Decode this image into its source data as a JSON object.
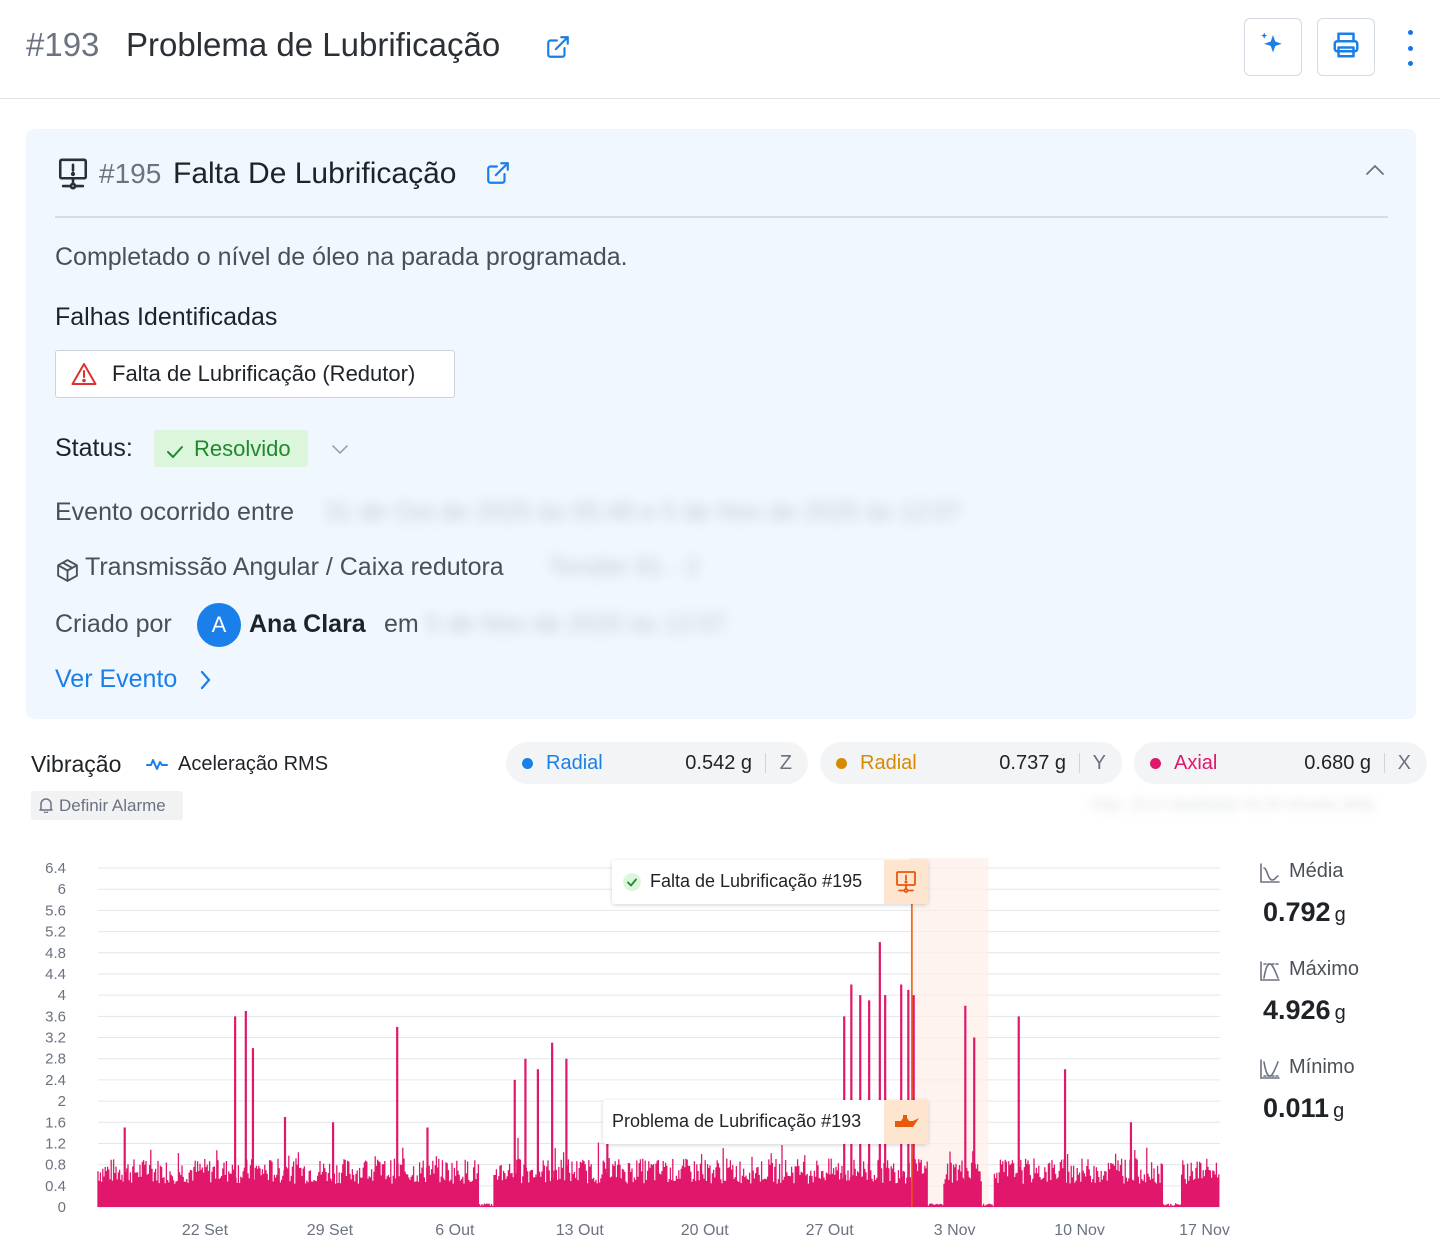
{
  "header": {
    "number": "#193",
    "title": "Problema de Lubrificação",
    "icons": [
      "external-link-icon",
      "sparkles-icon",
      "print-icon",
      "kebab-icon"
    ]
  },
  "event": {
    "number": "#195",
    "title": "Falta De Lubrificação",
    "description": "Completado o nível de óleo na parada programada.",
    "faults_heading": "Falhas Identificadas",
    "fault_label": "Falta de Lubrificação",
    "fault_component": "(Redutor)",
    "status_label": "Status:",
    "status_value": "Resolvido",
    "occurred_label": "Evento ocorrido entre",
    "occurred_value": "31 de Out de 2025 às 05:48 e 5 de Nov de 2025 às 12:07",
    "asset_path": "Transmissão Angular / Caixa redutora",
    "asset_tag": "Torsiler 81 - 2",
    "created_by_label": "Criado por",
    "avatar_initial": "A",
    "user_name": "Ana Clara",
    "created_on_label": "em",
    "created_on_value": "5 de Nov de 2025 às 12:07",
    "link_label": "Ver Evento"
  },
  "vibration": {
    "title": "Vibração",
    "subtitle": "Aceleração RMS",
    "alarm_button": "Definir Alarme",
    "blurred_note": "Hoje, 18:14 atualizado há 34 minutos atrás",
    "pills": [
      {
        "name": "Radial",
        "value": "0.542 g",
        "axis": "Z",
        "color": "#1a7fe8"
      },
      {
        "name": "Radial",
        "value": "0.737 g",
        "axis": "Y",
        "color": "#d68a00"
      },
      {
        "name": "Axial",
        "value": "0.680 g",
        "axis": "X",
        "color": "#e0176b"
      }
    ],
    "annotations": [
      {
        "label": "Falta de Lubrificação #195"
      },
      {
        "label": "Problema de Lubrificação #193"
      }
    ],
    "stats": [
      {
        "label": "Média",
        "value": "0.792",
        "unit": "g"
      },
      {
        "label": "Máximo",
        "value": "4.926",
        "unit": "g"
      },
      {
        "label": "Mínimo",
        "value": "0.011",
        "unit": "g"
      }
    ]
  },
  "chart_data": {
    "type": "area",
    "title": "",
    "xlabel": "",
    "ylabel": "",
    "ylim": [
      0,
      6.4
    ],
    "y_ticks": [
      "0",
      "0.4",
      "0.8",
      "1.2",
      "1.6",
      "2",
      "2.4",
      "2.8",
      "3.2",
      "3.6",
      "4",
      "4.4",
      "4.8",
      "5.2",
      "5.6",
      "6",
      "6.4"
    ],
    "x_ticks": [
      "22 Set",
      "29 Set",
      "6 Out",
      "13 Out",
      "20 Out",
      "27 Out",
      "3 Nov",
      "10 Nov",
      "17 Nov"
    ],
    "x_range_days": [
      0,
      63
    ],
    "series_color": "#e0176b",
    "baseline_level": 0.8,
    "peaks": [
      {
        "day": 1.5,
        "y": 1.5
      },
      {
        "day": 7.7,
        "y": 3.6
      },
      {
        "day": 8.3,
        "y": 3.7
      },
      {
        "day": 8.7,
        "y": 3.0
      },
      {
        "day": 10.5,
        "y": 1.7
      },
      {
        "day": 13.2,
        "y": 1.6
      },
      {
        "day": 16.8,
        "y": 3.4
      },
      {
        "day": 18.5,
        "y": 1.5
      },
      {
        "day": 23.4,
        "y": 2.4
      },
      {
        "day": 24.0,
        "y": 2.8
      },
      {
        "day": 24.7,
        "y": 2.6
      },
      {
        "day": 25.5,
        "y": 3.1
      },
      {
        "day": 26.3,
        "y": 2.8
      },
      {
        "day": 28.6,
        "y": 1.5
      },
      {
        "day": 41.9,
        "y": 3.6
      },
      {
        "day": 42.3,
        "y": 4.2
      },
      {
        "day": 42.8,
        "y": 4.0
      },
      {
        "day": 43.3,
        "y": 3.9
      },
      {
        "day": 43.9,
        "y": 5.0
      },
      {
        "day": 44.2,
        "y": 4.0
      },
      {
        "day": 45.1,
        "y": 4.2
      },
      {
        "day": 45.5,
        "y": 4.1
      },
      {
        "day": 45.8,
        "y": 4.0
      },
      {
        "day": 48.7,
        "y": 3.8
      },
      {
        "day": 49.2,
        "y": 3.2
      },
      {
        "day": 51.7,
        "y": 3.6
      },
      {
        "day": 54.3,
        "y": 2.6
      },
      {
        "day": 58.0,
        "y": 1.6
      }
    ],
    "gaps_days": [
      [
        21.4,
        22.2
      ],
      [
        46.6,
        47.5
      ],
      [
        49.6,
        50.3
      ],
      [
        59.8,
        60.8
      ]
    ],
    "event_window_days": [
      45.6,
      50.0
    ],
    "event_marker_day": 45.7
  }
}
